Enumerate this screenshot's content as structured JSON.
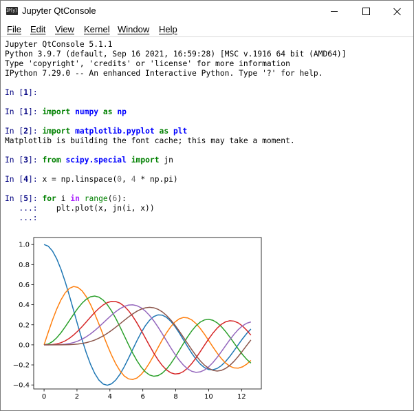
{
  "window": {
    "title": "Jupyter QtConsole",
    "icon": "IP[y]:"
  },
  "menu": [
    {
      "key": "F",
      "rest": "ile"
    },
    {
      "key": "E",
      "rest": "dit"
    },
    {
      "key": "V",
      "rest": "iew"
    },
    {
      "key": "K",
      "rest": "ernel"
    },
    {
      "key": "W",
      "rest": "indow"
    },
    {
      "key": "H",
      "rest": "elp"
    }
  ],
  "banner": [
    "Jupyter QtConsole 5.1.1",
    "Python 3.9.7 (default, Sep 16 2021, 16:59:28) [MSC v.1916 64 bit (AMD64)]",
    "Type 'copyright', 'credits' or 'license' for more information",
    "IPython 7.29.0 -- An enhanced Interactive Python. Type '?' for help."
  ],
  "cells": [
    {
      "prompt": "In [",
      "num": "1",
      "close": "]:",
      "code": ""
    },
    {
      "prompt": "In [",
      "num": "1",
      "close": "]:",
      "kw1": "import",
      "mod": "numpy",
      "kw2": "as",
      "mod2": "np"
    },
    {
      "prompt": "In [",
      "num": "2",
      "close": "]:",
      "kw1": "import",
      "mod": "matplotlib.pyplot",
      "kw2": "as",
      "mod2": "plt"
    },
    {
      "output": "Matplotlib is building the font cache; this may take a moment."
    },
    {
      "prompt": "In [",
      "num": "3",
      "close": "]:",
      "kw1": "from",
      "mod": "scipy.special",
      "kw2": "import",
      "name": "jn"
    },
    {
      "prompt": "In [",
      "num": "4",
      "close": "]:",
      "code_a": "x = np.linspace(",
      "n0": "0",
      "code_b": ", ",
      "n4": "4",
      "code_c": " * np.pi)"
    },
    {
      "prompt": "In [",
      "num": "5",
      "close": "]:",
      "kw_for": "for",
      "var": " i ",
      "kw_in": "in",
      "fn": "range",
      "arg": "6",
      "tail": "):"
    },
    {
      "cont": "   ...:",
      "code": "    plt.plot(x, jn(i, x))"
    },
    {
      "cont": "   ...:",
      "code": ""
    }
  ],
  "chart_data": {
    "type": "line",
    "title": "",
    "xlabel": "",
    "ylabel": "",
    "xlim": [
      -0.63,
      13.2
    ],
    "ylim": [
      -0.44,
      1.07
    ],
    "xticks": [
      "0",
      "2",
      "4",
      "6",
      "8",
      "10",
      "12"
    ],
    "yticks": [
      "−0.4",
      "−0.2",
      "0.0",
      "0.2",
      "0.4",
      "0.6",
      "0.8",
      "1.0"
    ],
    "grid": false,
    "x_range": [
      0,
      12.566
    ],
    "series": [
      {
        "color": "#1f77b4",
        "order": 0
      },
      {
        "color": "#ff7f0e",
        "order": 1
      },
      {
        "color": "#2ca02c",
        "order": 2
      },
      {
        "color": "#d62728",
        "order": 3
      },
      {
        "color": "#9467bd",
        "order": 4
      },
      {
        "color": "#8c564b",
        "order": 5
      }
    ]
  }
}
